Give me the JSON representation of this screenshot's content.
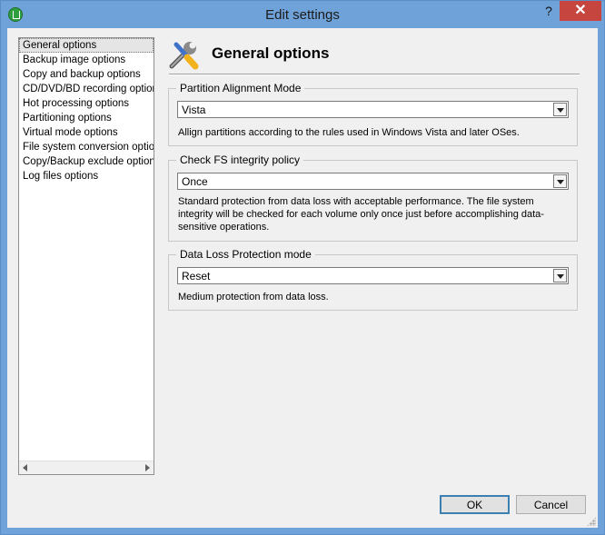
{
  "window": {
    "title": "Edit settings",
    "help_label": "?",
    "close_label": "✕"
  },
  "sidebar": {
    "items": [
      {
        "label": "General options",
        "selected": true
      },
      {
        "label": "Backup image options"
      },
      {
        "label": "Copy and backup options"
      },
      {
        "label": "CD/DVD/BD recording options"
      },
      {
        "label": "Hot processing options"
      },
      {
        "label": "Partitioning options"
      },
      {
        "label": "Virtual mode options"
      },
      {
        "label": "File system conversion options"
      },
      {
        "label": "Copy/Backup exclude options"
      },
      {
        "label": "Log files options"
      }
    ]
  },
  "header": {
    "title": "General options",
    "icon": "tools-icon"
  },
  "groups": {
    "partition_alignment": {
      "legend": "Partition Alignment Mode",
      "value": "Vista",
      "description": "Allign partitions according to the rules used in Windows Vista and later OSes."
    },
    "fs_integrity": {
      "legend": "Check FS integrity policy",
      "value": "Once",
      "description": "Standard protection from data loss with acceptable performance. The file system integrity will be checked for each volume only once just before accomplishing data-sensitive operations."
    },
    "data_loss": {
      "legend": "Data Loss Protection mode",
      "value": "Reset",
      "description": "Medium protection from data loss."
    }
  },
  "buttons": {
    "ok": "OK",
    "cancel": "Cancel"
  }
}
